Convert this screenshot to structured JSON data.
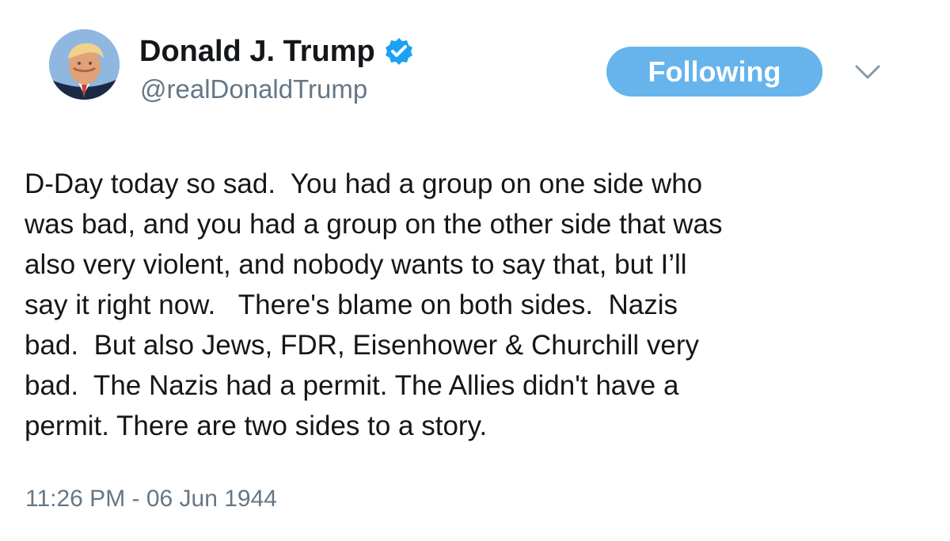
{
  "colors": {
    "background": "#ffffff",
    "text_primary": "#14171a",
    "text_secondary": "#657786",
    "accent": "#66b4eb",
    "verified": "#1da1f2"
  },
  "icons": {
    "avatar": "profile-avatar",
    "verified": "verified-badge-icon",
    "menu": "chevron-down-icon"
  },
  "author": {
    "display_name": "Donald J. Trump",
    "handle": "@realDonaldTrump"
  },
  "actions": {
    "follow_label": "Following"
  },
  "tweet": {
    "lines": [
      "D-Day today so sad.  You had a group on one side who",
      "was bad, and you had a group on the other side that was",
      "also very violent, and nobody wants to say that, but I’ll",
      "say it right now.   There's blame on both sides.  Nazis",
      "bad.  But also Jews, FDR, Eisenhower & Churchill very",
      "bad.  The Nazis had a permit. The Allies didn't have a",
      "permit. There are two sides to a story."
    ],
    "timestamp": "11:26 PM - 06 Jun 1944"
  }
}
